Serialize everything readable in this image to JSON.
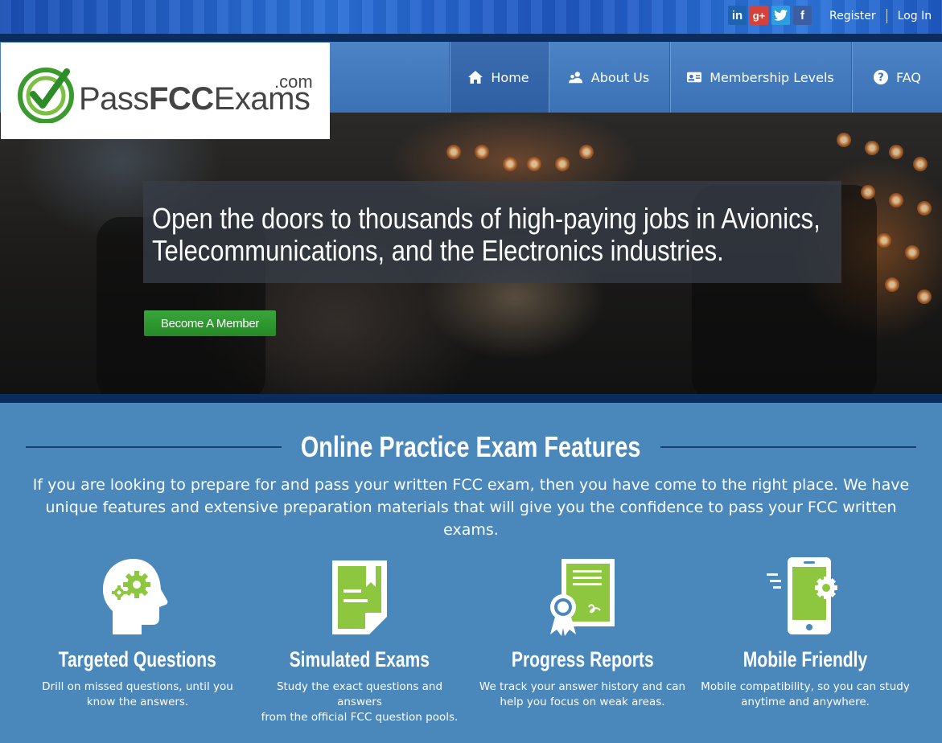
{
  "topbar": {
    "social": [
      {
        "name": "linkedin-icon",
        "glyph": "in"
      },
      {
        "name": "googleplus-icon",
        "glyph": "g+"
      },
      {
        "name": "twitter-icon",
        "glyph": "t"
      },
      {
        "name": "facebook-icon",
        "glyph": "f"
      }
    ],
    "register_label": "Register",
    "login_label": "Log In"
  },
  "logo": {
    "part1": "Pass",
    "part2": "FCC",
    "part3": "Exams",
    "suffix": ".com"
  },
  "nav": {
    "home": "Home",
    "about": "About Us",
    "membership": "Membership Levels",
    "faq": "FAQ"
  },
  "hero": {
    "line1": "Open the doors to thousands of high-paying jobs in Avionics,",
    "line2": "Telecommunications, and the Electronics industries.",
    "cta_label": "Become A Member"
  },
  "features": {
    "title": "Online Practice Exam Features",
    "intro_line1": "If you are looking to prepare for and pass your written FCC exam, then you have come to the right place. We have",
    "intro_line2": "unique features and extensive preparation materials that will give you the confidence to pass your FCC written exams.",
    "items": [
      {
        "title": "Targeted Questions",
        "desc1": "Drill on missed questions, until you",
        "desc2": "know the answers.",
        "icon": "head-gears-icon"
      },
      {
        "title": "Simulated Exams",
        "desc1": "Study the exact questions and answers",
        "desc2": "from the official FCC question pools.",
        "icon": "document-bookmark-icon"
      },
      {
        "title": "Progress Reports",
        "desc1": "We track your answer history and can",
        "desc2": "help you focus on weak areas.",
        "icon": "certificate-icon"
      },
      {
        "title": "Mobile Friendly",
        "desc1": "Mobile compatibility, so you can study",
        "desc2": "anytime and anywhere.",
        "icon": "mobile-phone-icon"
      }
    ]
  },
  "colors": {
    "accent_green": "#8dc63f",
    "nav_blue": "#3b71b5",
    "dark_strip": "#0a2d5e",
    "features_bg": "#4a87bb",
    "cta_green": "#2f9a31"
  }
}
